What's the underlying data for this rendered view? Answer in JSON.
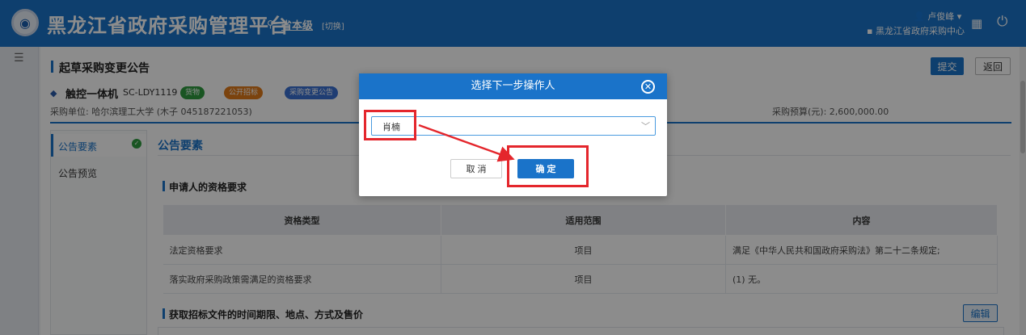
{
  "header": {
    "title": "黑龙江省政府采购管理平台",
    "level": "省本级",
    "switch_label": "[切换]",
    "user": "卢俊峰",
    "org": "黑龙江省政府采购中心"
  },
  "page": {
    "title": "起草采购变更公告",
    "submit_label": "提交",
    "back_label": "返回"
  },
  "product": {
    "name": "触控一体机",
    "code": "SC-LDY1119",
    "tags": [
      "货物",
      "公开招标",
      "采购变更公告"
    ],
    "unit_line": "采购单位: 哈尔滨理工大学 (木子 045187221053)",
    "budget": "采购预算(元): 2,600,000.00"
  },
  "side_nav": {
    "items": [
      "公告要素",
      "公告预览"
    ]
  },
  "section": {
    "title": "公告要素",
    "sub1": "申请人的资格要求",
    "sub2": "获取招标文件的时间期限、地点、方式及售价",
    "edit_label": "编辑"
  },
  "table": {
    "headers": [
      "资格类型",
      "适用范围",
      "内容"
    ],
    "rows": [
      [
        "法定资格要求",
        "项目",
        "满足《中华人民共和国政府采购法》第二十二条规定;"
      ],
      [
        "落实政府采购政策需满足的资格要求",
        "项目",
        "(1) 无。"
      ]
    ]
  },
  "modal": {
    "title": "选择下一步操作人",
    "selected_value": "肖楠",
    "cancel_label": "取 消",
    "ok_label": "确 定"
  },
  "colors": {
    "brand": "#1a73c9",
    "highlight": "#e4262c",
    "tag_green": "#2e9b3e",
    "tag_orange": "#e07b1a",
    "tag_blue": "#3a6fd1"
  },
  "icons": [
    "emblem-logo",
    "location-pin-icon",
    "user-icon",
    "dropdown-caret-icon",
    "org-icon",
    "apps-grid-icon",
    "power-icon",
    "menu-icon",
    "diamond-icon",
    "check-circle-icon",
    "close-circle-icon",
    "chevron-down-icon"
  ]
}
